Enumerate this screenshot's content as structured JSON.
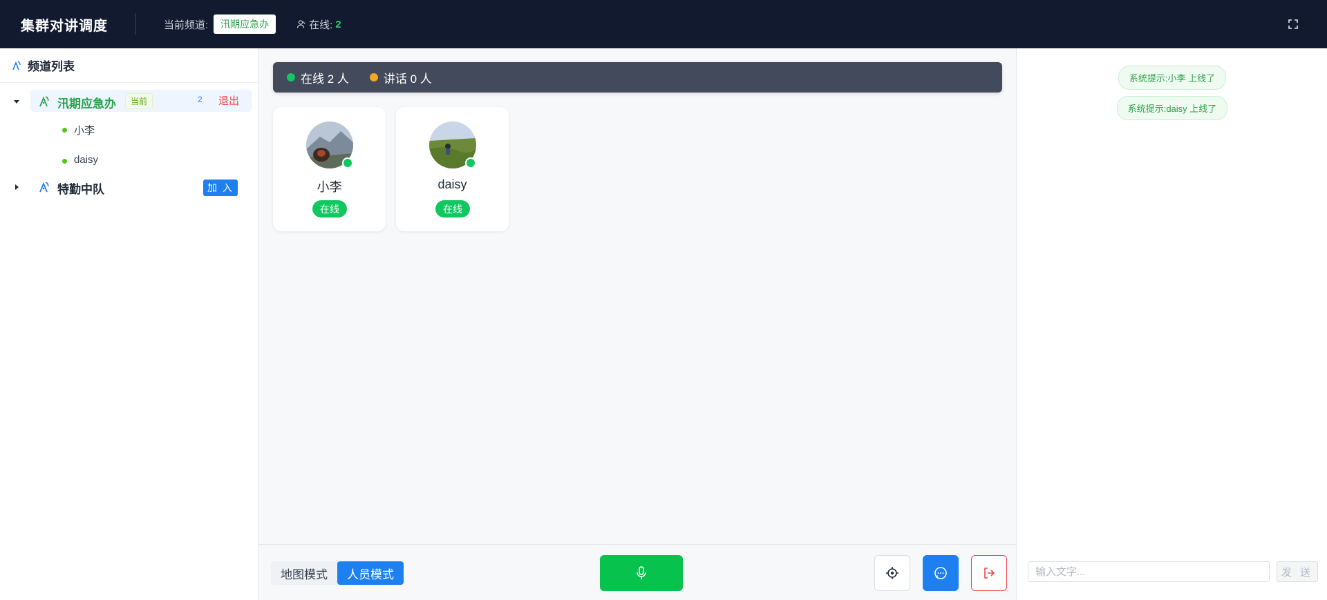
{
  "header": {
    "title": "集群对讲调度",
    "channel_label": "当前频道:",
    "channel_name": "汛期应急办",
    "online_label": "在线:",
    "online_count": "2",
    "fullscreen_icon": "fullscreen-icon"
  },
  "sidebar": {
    "title": "频道列表",
    "channels": [
      {
        "name": "汛期应急办",
        "expanded": true,
        "current_tag": "当前",
        "member_count": "2",
        "action_label": "退出",
        "members": [
          {
            "name": "小李"
          },
          {
            "name": "daisy"
          }
        ]
      },
      {
        "name": "特勤中队",
        "expanded": false,
        "action_label": "加 入"
      }
    ]
  },
  "main": {
    "stats": {
      "online_text": "在线 2 人",
      "talking_text": "讲话 0 人",
      "online_color": "#10c760",
      "talking_color": "#f5a623"
    },
    "cards": [
      {
        "name": "小李",
        "status": "在线"
      },
      {
        "name": "daisy",
        "status": "在线"
      }
    ],
    "bottom": {
      "map_mode_label": "地图模式",
      "person_mode_label": "人员模式",
      "ptt_icon": "microphone-icon",
      "locate_icon": "locate-icon",
      "chat_icon": "chat-icon",
      "exit_icon": "exit-icon"
    }
  },
  "chat": {
    "messages": [
      {
        "text": "系统提示:小李 上线了"
      },
      {
        "text": "系统提示:daisy 上线了"
      }
    ],
    "input_placeholder": "输入文字...",
    "send_label": "发 送"
  },
  "colors": {
    "header_bg": "#111a2e",
    "accent_blue": "#1e7ff0",
    "accent_green": "#08c24e",
    "danger": "#ef4444"
  }
}
